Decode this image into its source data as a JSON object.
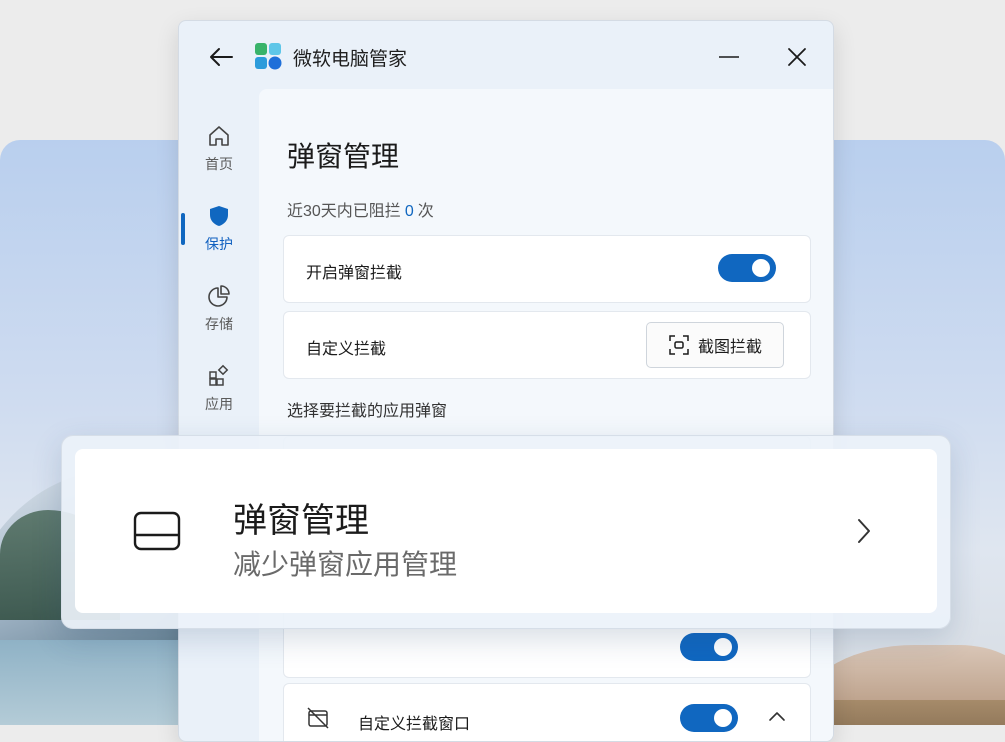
{
  "window": {
    "app_title": "微软电脑管家"
  },
  "nav": {
    "items": [
      {
        "label": "首页",
        "icon": "home-icon"
      },
      {
        "label": "保护",
        "icon": "shield-icon",
        "active": true
      },
      {
        "label": "存储",
        "icon": "pie-chart-icon"
      },
      {
        "label": "应用",
        "icon": "apps-icon"
      }
    ]
  },
  "page": {
    "title": "弹窗管理",
    "blocked_prefix": "近30天内已阻拦",
    "blocked_count": "0",
    "blocked_suffix": "次",
    "enable_label": "开启弹窗拦截",
    "enable_on": true,
    "custom_label": "自定义拦截",
    "screenshot_button": "截图拦截",
    "section_label": "选择要拦截的应用弹窗",
    "custom_window_label": "自定义拦截窗口",
    "custom_window_on": true
  },
  "overlay": {
    "title": "弹窗管理",
    "subtitle": "减少弹窗应用管理",
    "icon": "popup-window-icon"
  },
  "colors": {
    "accent": "#1067c0"
  }
}
